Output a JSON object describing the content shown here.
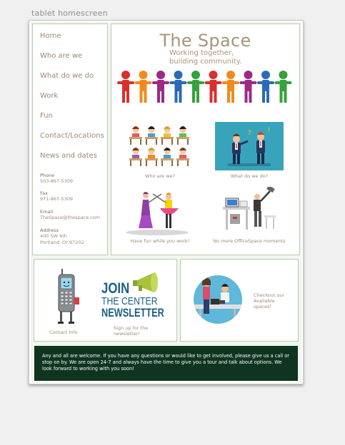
{
  "caption": "tablet homescreen",
  "nav": [
    "Home",
    "Who are we",
    "What do we do",
    "Work",
    "Fun",
    "Contact/Locations",
    "News and dates"
  ],
  "contact": {
    "phone_label": "Phone",
    "phone": "503-867-5309",
    "fax_label": "Fax",
    "fax": "971-867-5309",
    "email_label": "Email",
    "email": "TheSpace@thespace.com",
    "address_label": "Address",
    "address_line1": "400 SW 6th",
    "address_line2": "Portland, Or 97202"
  },
  "hero": {
    "title": "The Space",
    "tagline_line1": "Working together,",
    "tagline_line2": "building community."
  },
  "thumbs": [
    "Who are we?",
    "What do we do?",
    "Have fun while you work!",
    "No more OfficeSpace moments"
  ],
  "newsletter": {
    "contact_caption": "Contact Info",
    "logo_line1": "JOIN",
    "logo_line2": "THE CENTER",
    "logo_line3": "NEWSLETTER",
    "signup_line1": "Sign up for the",
    "signup_line2": "newsletter!"
  },
  "spaces": {
    "line1": "Checkout our",
    "line2": "Available",
    "line3": "spaces!"
  },
  "footer": "Any and all are welcome.  If you have any questions or would like to get involved, please give us a call or stop on by.  We are open 24-7 and always have the time to give you a tour and talk about options.  We look forward to working with you soon!",
  "colors": {
    "accent": "#a79479",
    "border": "#b6ccad",
    "footer_bg": "#0f3420"
  }
}
